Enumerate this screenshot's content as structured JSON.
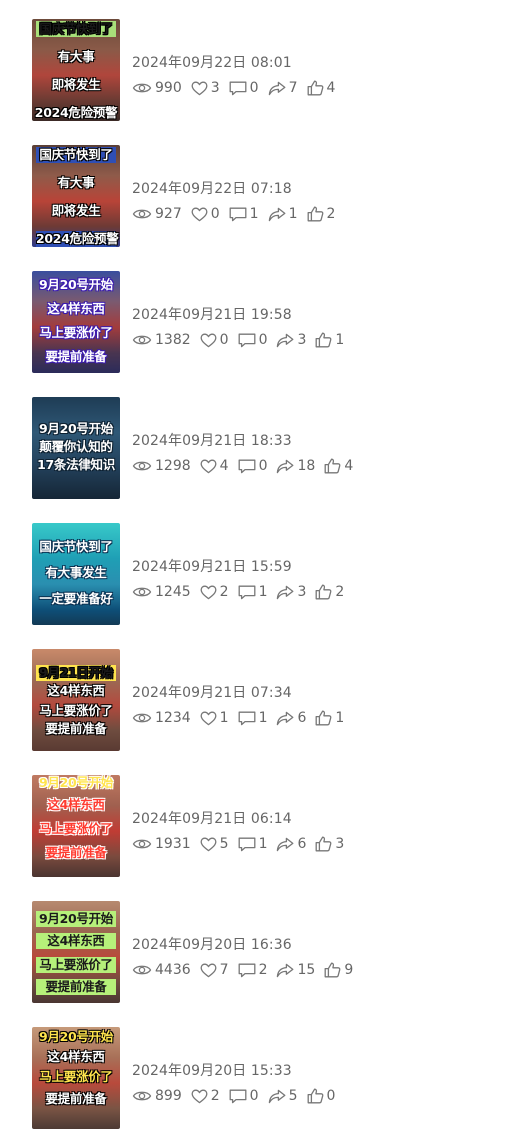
{
  "posts": [
    {
      "time": "2024年09月22日 08:01",
      "views": "990",
      "likes": "3",
      "comments": "0",
      "shares": "7",
      "thumbs": "4",
      "caption": [
        "国庆节快到了",
        "有大事",
        "即将发生",
        "2024危险预警"
      ],
      "style": "crowd_a"
    },
    {
      "time": "2024年09月22日 07:18",
      "views": "927",
      "likes": "0",
      "comments": "1",
      "shares": "1",
      "thumbs": "2",
      "caption": [
        "国庆节快到了",
        "有大事",
        "即将发生",
        "2024危险预警"
      ],
      "style": "crowd_b"
    },
    {
      "time": "2024年09月21日 19:58",
      "views": "1382",
      "likes": "0",
      "comments": "0",
      "shares": "3",
      "thumbs": "1",
      "caption": [
        "9月20号开始",
        "这4样东西",
        "马上要涨价了",
        "要提前准备"
      ],
      "style": "crowd_c"
    },
    {
      "time": "2024年09月21日 18:33",
      "views": "1298",
      "likes": "4",
      "comments": "0",
      "shares": "18",
      "thumbs": "4",
      "caption": [
        "9月20号开始",
        "颠覆你认知的",
        "17条法律知识"
      ],
      "style": "rain"
    },
    {
      "time": "2024年09月21日 15:59",
      "views": "1245",
      "likes": "2",
      "comments": "1",
      "shares": "3",
      "thumbs": "2",
      "caption": [
        "国庆节快到了",
        "有大事发生",
        "一定要准备好"
      ],
      "style": "teal"
    },
    {
      "time": "2024年09月21日 07:34",
      "views": "1234",
      "likes": "1",
      "comments": "1",
      "shares": "6",
      "thumbs": "1",
      "caption": [
        "9月21日开始",
        "这4样东西",
        "马上要涨价了",
        "要提前准备"
      ],
      "style": "market_a"
    },
    {
      "time": "2024年09月21日 06:14",
      "views": "1931",
      "likes": "5",
      "comments": "1",
      "shares": "6",
      "thumbs": "3",
      "caption": [
        "9月20号开始",
        "这4样东西",
        "马上要涨价了",
        "要提前准备"
      ],
      "style": "market_b"
    },
    {
      "time": "2024年09月20日 16:36",
      "views": "4436",
      "likes": "7",
      "comments": "2",
      "shares": "15",
      "thumbs": "9",
      "caption": [
        "9月20号开始",
        "这4样东西",
        "马上要涨价了",
        "要提前准备"
      ],
      "style": "market_c"
    },
    {
      "time": "2024年09月20日 15:33",
      "views": "899",
      "likes": "2",
      "comments": "0",
      "shares": "5",
      "thumbs": "0",
      "caption": [
        "9月20号开始",
        "这4样东西",
        "马上要涨价了",
        "要提前准备"
      ],
      "style": "market_d"
    }
  ],
  "icons": {
    "views": "eye-icon",
    "likes": "heart-icon",
    "comments": "comment-icon",
    "shares": "share-icon",
    "thumbs": "thumbs-up-icon"
  },
  "colors": {
    "text": "#666666",
    "icon": "#777777"
  }
}
